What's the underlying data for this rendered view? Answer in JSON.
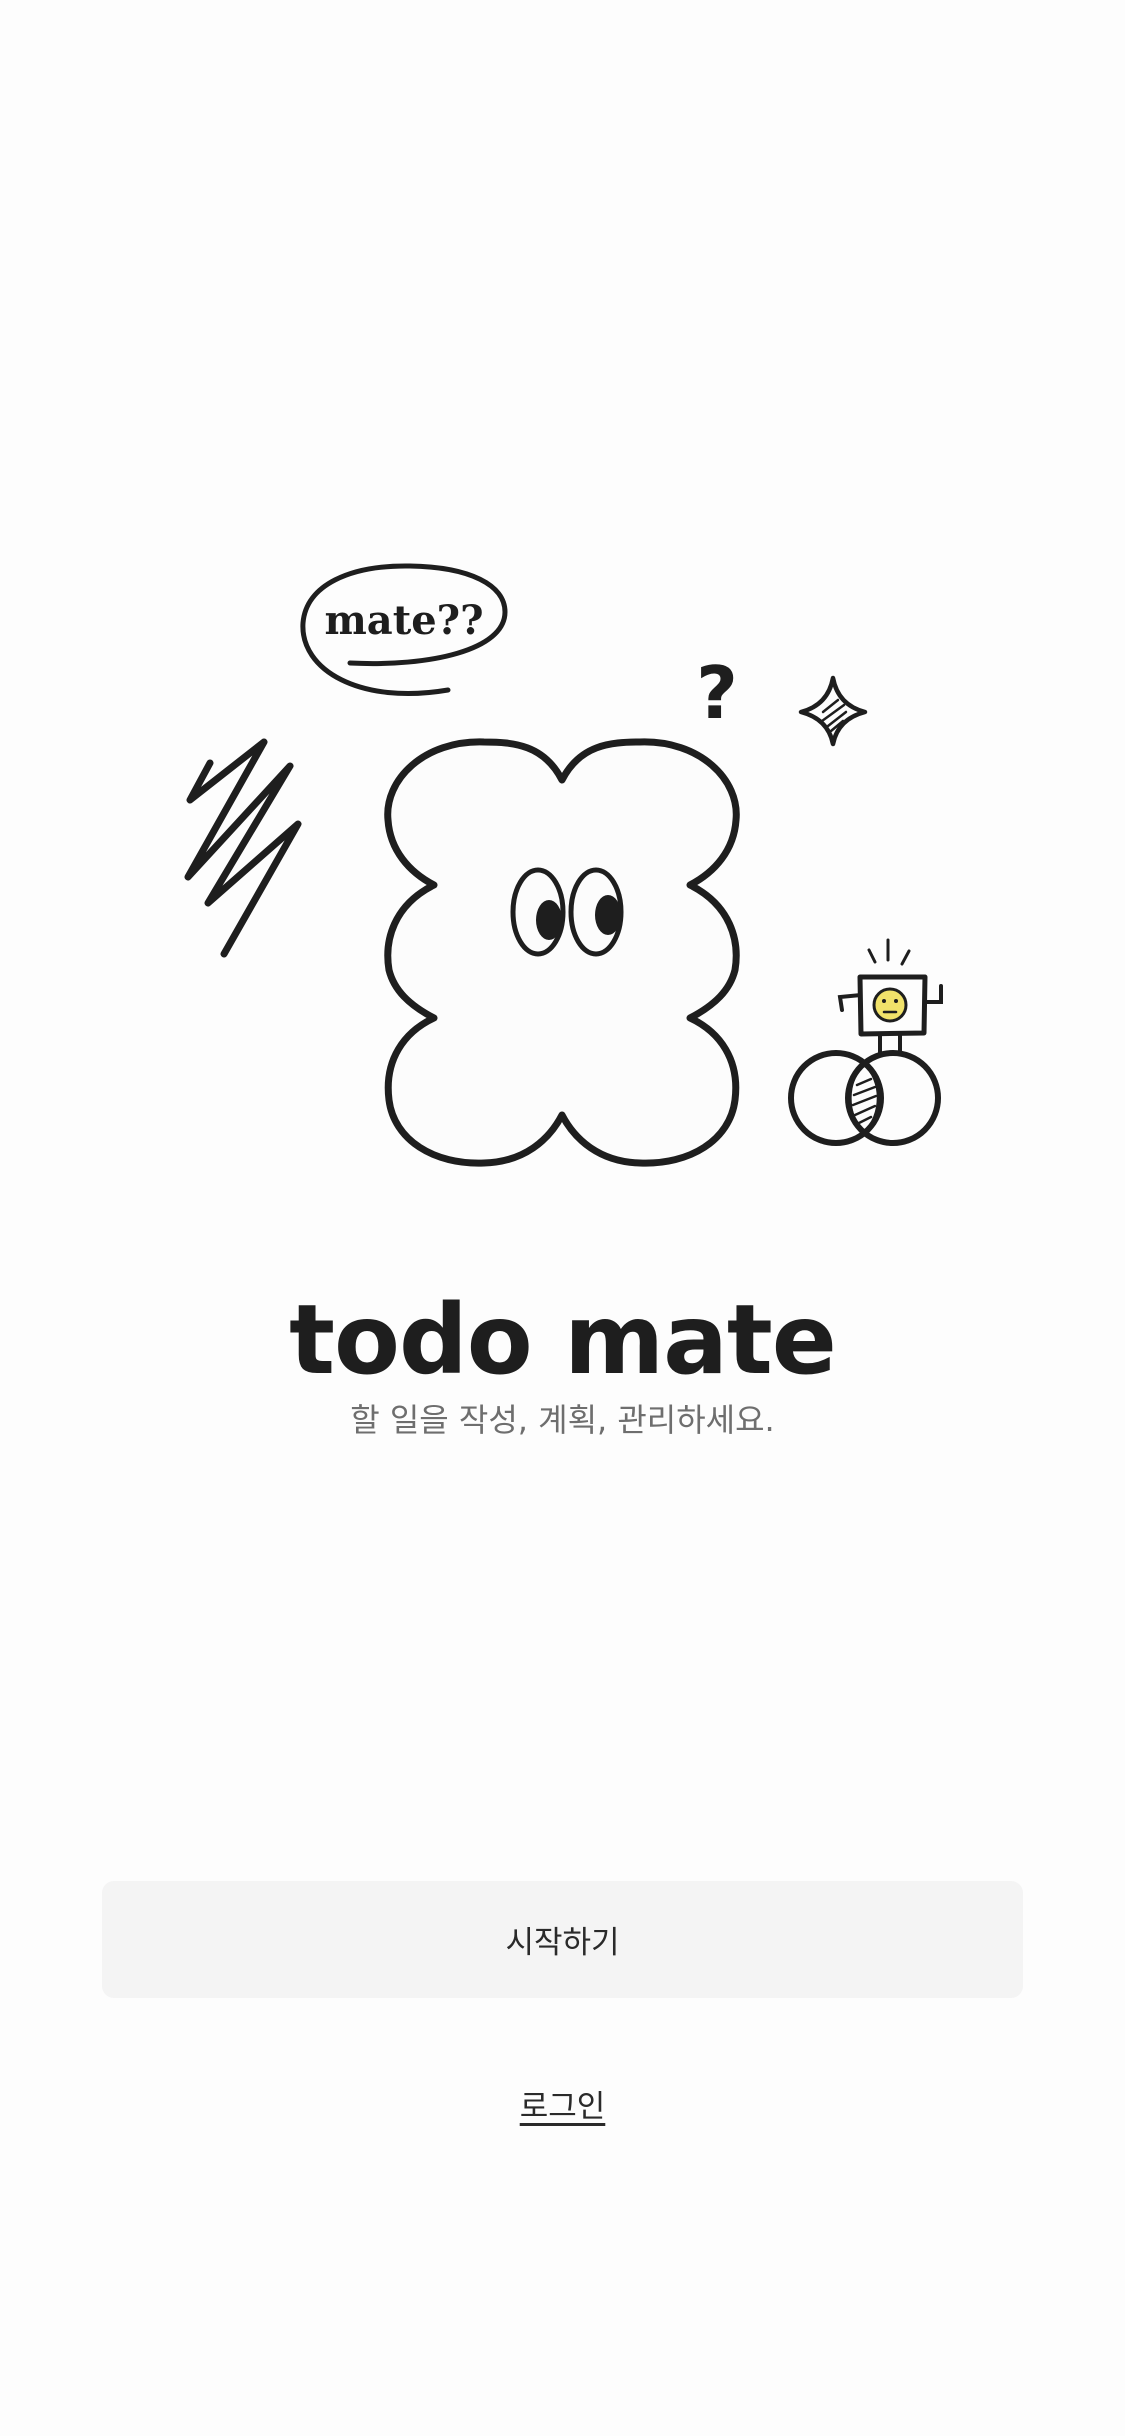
{
  "illustration": {
    "bubble_text": "mate??",
    "question_mark": "?",
    "icons": [
      "speech-bubble-icon",
      "scribble-icon",
      "question-mark-icon",
      "sparkle-icon",
      "cloud-mascot-icon",
      "robot-on-circles-icon"
    ],
    "colors": {
      "stroke": "#1e1e1e",
      "cloud_fill": "#fcfcfc",
      "robot_face": "#f1e26a"
    }
  },
  "app": {
    "title": "todo mate",
    "tagline": "할 일을 작성, 계획, 관리하세요."
  },
  "actions": {
    "start_label": "시작하기",
    "login_label": "로그인"
  }
}
